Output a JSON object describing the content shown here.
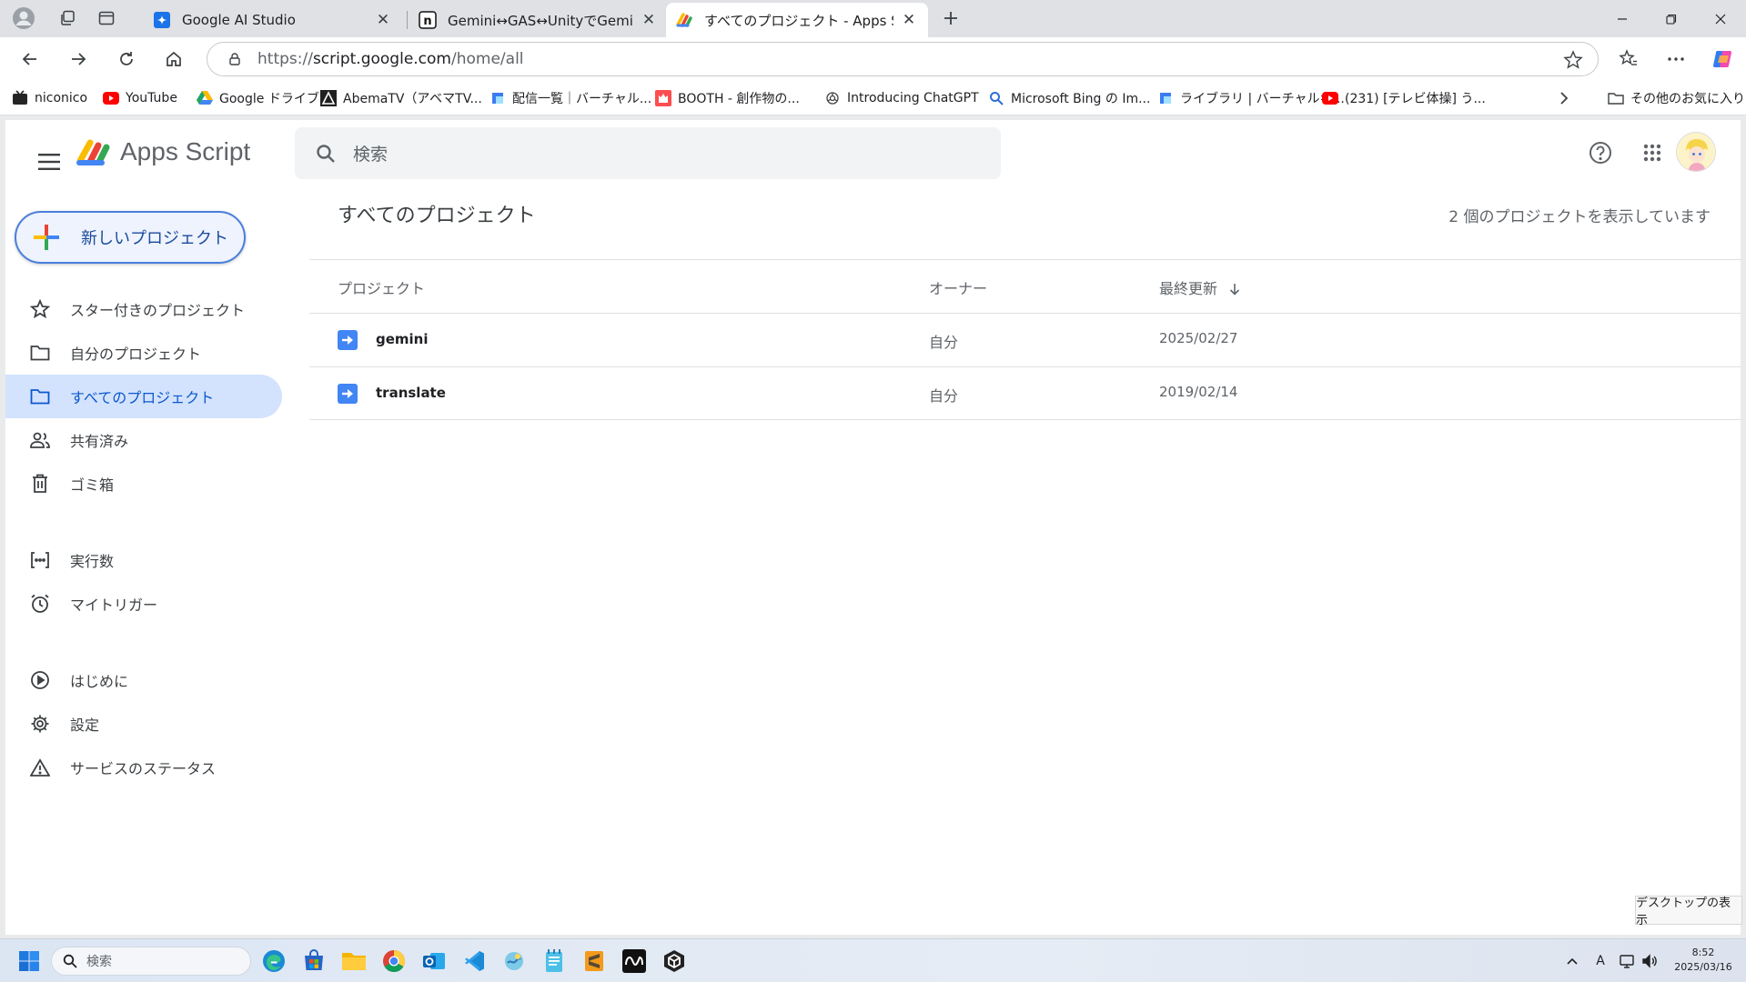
{
  "browser": {
    "tabs": [
      {
        "title": "Google AI Studio",
        "icon": "gemini-sparkle-icon",
        "active": false
      },
      {
        "title": "Gemini↔GAS↔UnityでGeminiを使",
        "icon": "notion-icon",
        "active": false
      },
      {
        "title": "すべてのプロジェクト - Apps Script",
        "icon": "apps-script-icon",
        "active": true
      }
    ],
    "url_prefix": "https://",
    "url_host": "script.google.com",
    "url_path": "/home/all"
  },
  "bookmarks": [
    {
      "label": "niconico",
      "icon": "niconico-icon",
      "color": "#252525"
    },
    {
      "label": "YouTube",
      "icon": "youtube-icon",
      "color": "#ff0000"
    },
    {
      "label": "Google ドライブ",
      "icon": "google-drive-icon",
      "color": "#1fa463"
    },
    {
      "label": "AbemaTV（アベマTV...",
      "icon": "abema-icon",
      "color": "#202020"
    },
    {
      "label": "配信一覧｜バーチャル...",
      "icon": "virtualcast-icon",
      "color": "#3d7bf0"
    },
    {
      "label": "BOOTH - 創作物の...",
      "icon": "booth-icon",
      "color": "#fc4d50"
    },
    {
      "label": "Introducing ChatGPT",
      "icon": "openai-icon",
      "color": "#444444"
    },
    {
      "label": "Microsoft Bing の Im...",
      "icon": "bing-search-icon",
      "color": "#2b6fd6"
    },
    {
      "label": "ライブラリ | バーチャルキ...",
      "icon": "virtualcast-icon",
      "color": "#3d7bf0"
    },
    {
      "label": "(231) [テレビ体操] う...",
      "icon": "youtube-icon",
      "color": "#ff0000"
    }
  ],
  "other_favorites": "その他のお気に入り",
  "app": {
    "name": "Apps Script",
    "search_placeholder": "検索",
    "new_project_label": "新しいプロジェクト"
  },
  "sidebar": {
    "items": [
      {
        "label": "スター付きのプロジェクト",
        "icon": "star-icon"
      },
      {
        "label": "自分のプロジェクト",
        "icon": "folder-icon"
      },
      {
        "label": "すべてのプロジェクト",
        "icon": "folder-icon",
        "active": true
      },
      {
        "label": "共有済み",
        "icon": "people-icon"
      },
      {
        "label": "ゴミ箱",
        "icon": "trash-icon"
      },
      {
        "label": "実行数",
        "icon": "executions-icon"
      },
      {
        "label": "マイトリガー",
        "icon": "alarm-icon"
      },
      {
        "label": "はじめに",
        "icon": "play-circle-icon"
      },
      {
        "label": "設定",
        "icon": "settings-icon"
      },
      {
        "label": "サービスのステータス",
        "icon": "warning-icon"
      }
    ]
  },
  "main": {
    "title": "すべてのプロジェクト",
    "count_text": "2 個のプロジェクトを表示しています",
    "columns": [
      "プロジェクト",
      "オーナー",
      "最終更新"
    ],
    "rows": [
      {
        "name": "gemini",
        "owner": "自分",
        "modified": "2025/02/27"
      },
      {
        "name": "translate",
        "owner": "自分",
        "modified": "2019/02/14"
      }
    ]
  },
  "desktop_tooltip": "デスクトップの表示",
  "taskbar": {
    "search_placeholder": "検索",
    "time": "8:52",
    "date": "2025/03/16",
    "ime": "A"
  },
  "colors": {
    "accent": "#0b57d0",
    "active_nav_bg": "#d3e3fd",
    "script_blue": "#4285f4"
  }
}
